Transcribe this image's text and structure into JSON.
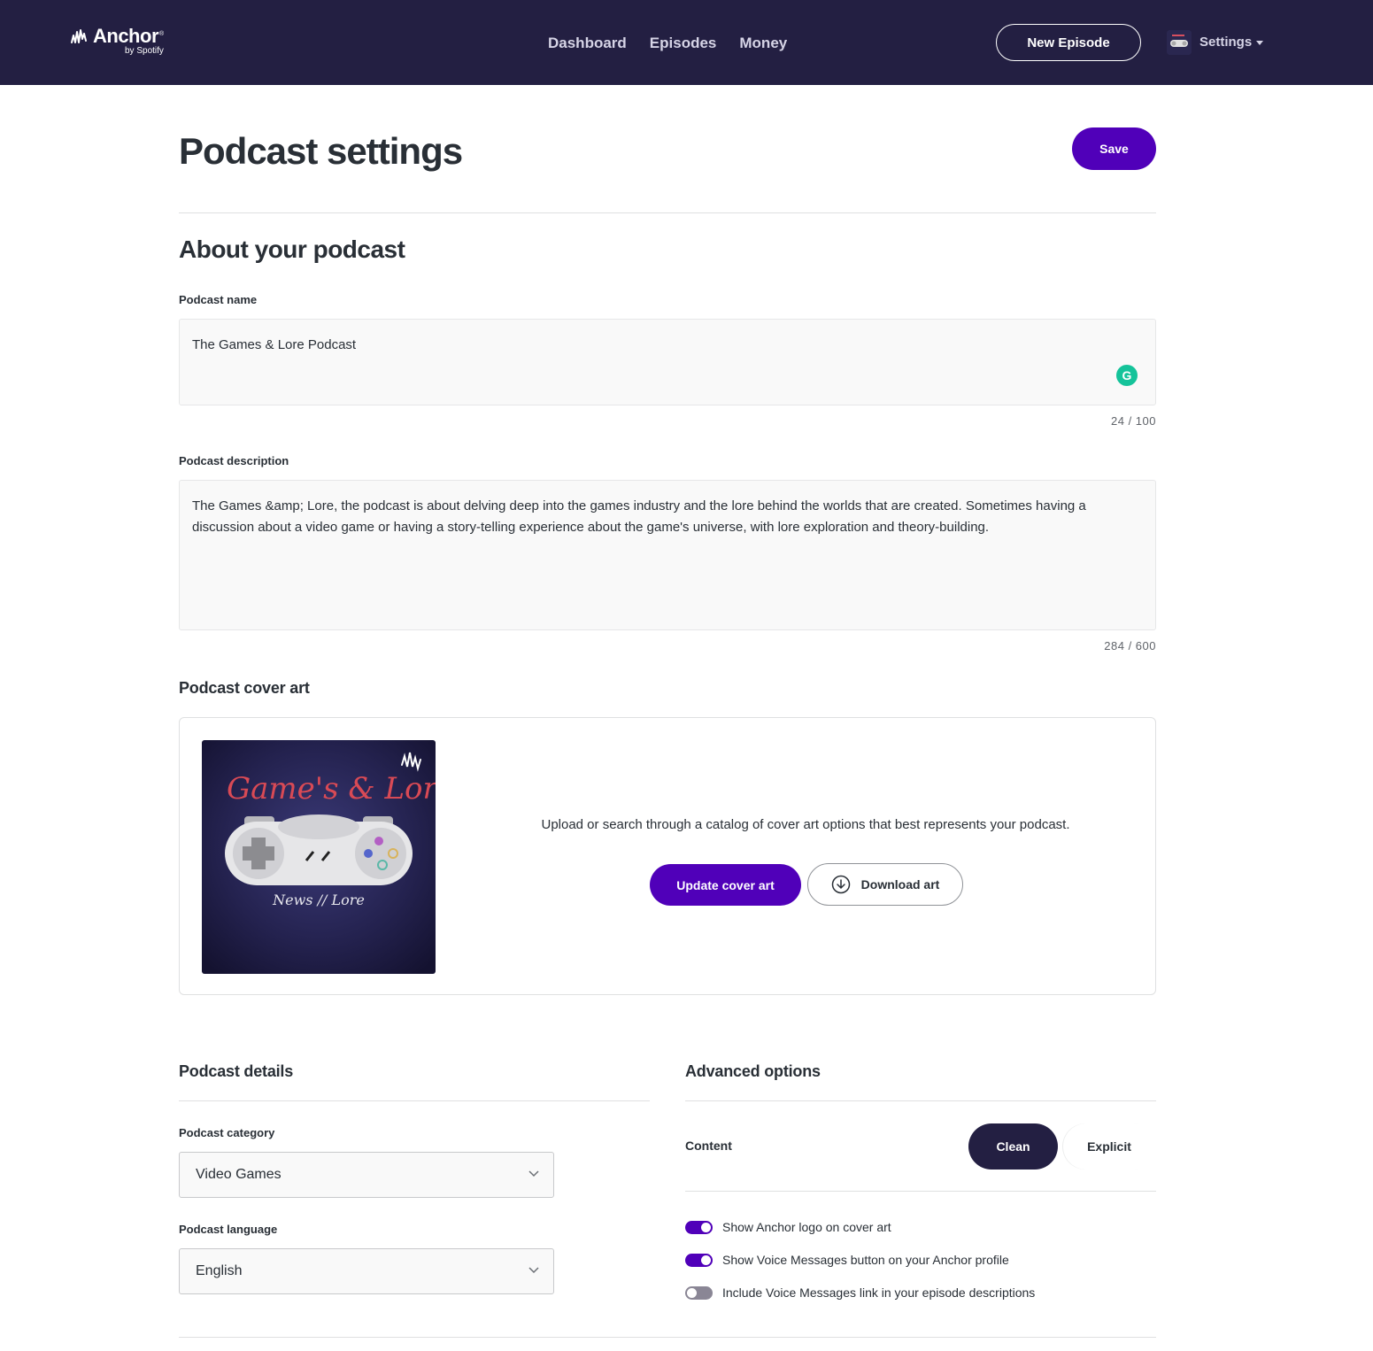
{
  "header": {
    "logo_text": "Anchor",
    "logo_sub": "by Spotify",
    "nav": [
      {
        "label": "Dashboard"
      },
      {
        "label": "Episodes"
      },
      {
        "label": "Money"
      }
    ],
    "new_episode_label": "New Episode",
    "settings_label": "Settings"
  },
  "page": {
    "title": "Podcast settings",
    "save_label": "Save"
  },
  "about": {
    "heading": "About your podcast",
    "name_label": "Podcast name",
    "name_value": "The Games & Lore Podcast",
    "name_counter": "24 / 100",
    "description_label": "Podcast description",
    "description_value": "The Games &amp; Lore, the podcast is about delving deep into the games industry and the lore behind the worlds that are created. Sometimes having a discussion about a video game or having a story-telling experience about the game's universe, with lore exploration and theory-building.",
    "description_counter": "284 / 600"
  },
  "cover": {
    "heading": "Podcast cover art",
    "art_title": "Game's & Lore",
    "art_subtitle": "News // Lore",
    "description": "Upload or search through a catalog of cover art options that best represents your podcast.",
    "update_label": "Update cover art",
    "download_label": "Download art"
  },
  "details": {
    "heading": "Podcast details",
    "category_label": "Podcast category",
    "category_value": "Video Games",
    "language_label": "Podcast language",
    "language_value": "English"
  },
  "advanced": {
    "heading": "Advanced options",
    "content_label": "Content",
    "clean_label": "Clean",
    "explicit_label": "Explicit",
    "selected_content": "Clean",
    "toggles": [
      {
        "label": "Show Anchor logo on cover art",
        "on": true
      },
      {
        "label": "Show Voice Messages button on your Anchor profile",
        "on": true
      },
      {
        "label": "Include Voice Messages link in your episode descriptions",
        "on": false
      }
    ]
  },
  "colors": {
    "header_bg": "#231f42",
    "primary": "#5000b9",
    "grammarly": "#15c39a"
  }
}
